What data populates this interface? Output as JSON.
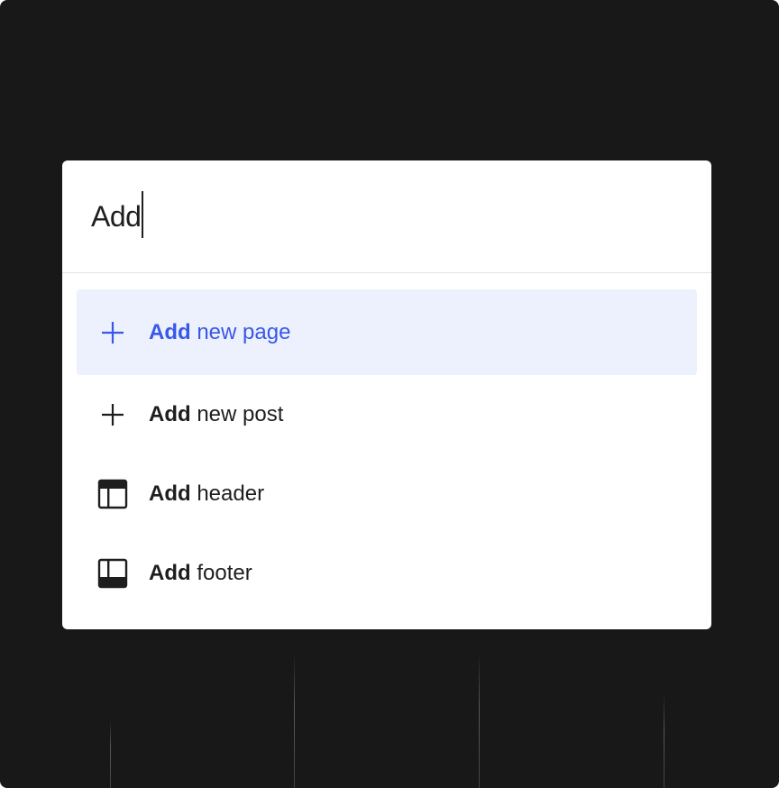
{
  "search": {
    "value": "Add"
  },
  "results": [
    {
      "match": "Add",
      "rest": " new page",
      "icon": "plus-icon",
      "active": true
    },
    {
      "match": "Add",
      "rest": " new post",
      "icon": "plus-icon",
      "active": false
    },
    {
      "match": "Add",
      "rest": " header",
      "icon": "header-layout-icon",
      "active": false
    },
    {
      "match": "Add",
      "rest": " footer",
      "icon": "footer-layout-icon",
      "active": false
    }
  ],
  "colors": {
    "backdrop": "#181818",
    "active_background": "#edf0fd",
    "accent": "#3858e9",
    "text": "#1e1e1e"
  }
}
